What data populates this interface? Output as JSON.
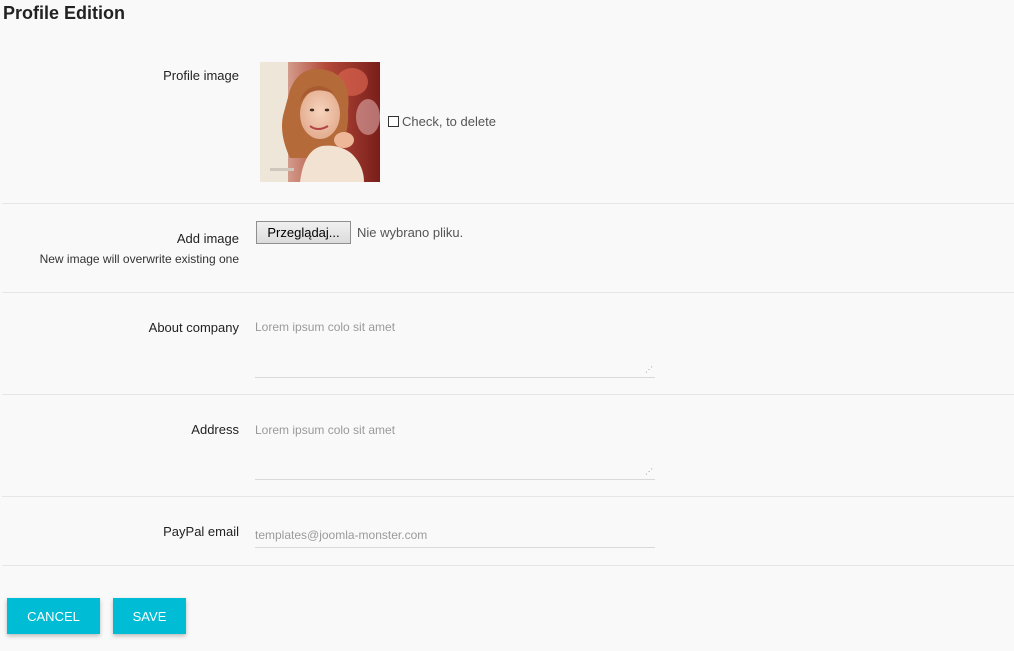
{
  "page": {
    "title": "Profile Edition"
  },
  "profile_image": {
    "label": "Profile image",
    "delete_label": "Check, to delete",
    "delete_checked": false
  },
  "add_image": {
    "label": "Add image",
    "hint": "New image will overwrite existing one",
    "browse_label": "Przeglądaj...",
    "file_status": "Nie wybrano pliku."
  },
  "about_company": {
    "label": "About company",
    "placeholder": "Lorem ipsum colo sit amet",
    "value": ""
  },
  "address": {
    "label": "Address",
    "placeholder": "Lorem ipsum colo sit amet",
    "value": ""
  },
  "paypal_email": {
    "label": "PayPal email",
    "placeholder": "templates@joomla-monster.com",
    "value": ""
  },
  "actions": {
    "cancel_label": "CANCEL",
    "save_label": "SAVE"
  },
  "colors": {
    "accent": "#00bcd4",
    "background": "#f9f9f9",
    "divider": "#e6e6e6"
  }
}
